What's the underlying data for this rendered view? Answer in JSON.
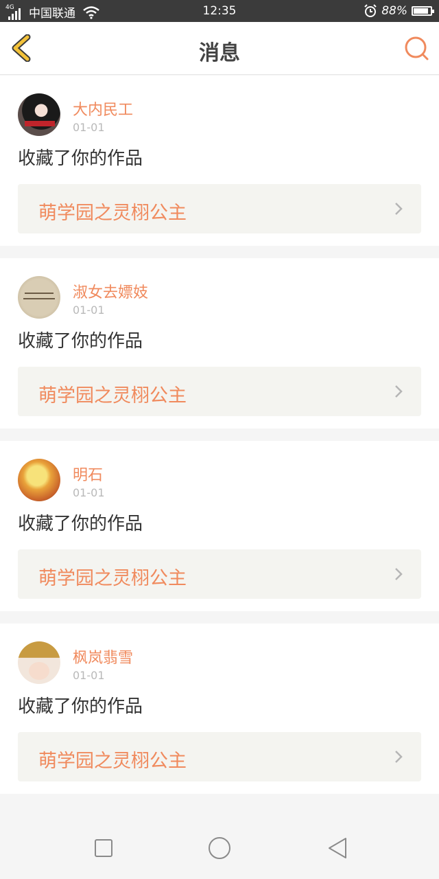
{
  "status_bar": {
    "network": "4G",
    "carrier": "中国联通",
    "time": "12:35",
    "battery": "88%",
    "battery_level": 0.88,
    "icons": [
      "signal-icon",
      "wifi-icon",
      "alarm-icon",
      "battery-icon"
    ]
  },
  "header": {
    "title": "消息",
    "back_icon": "chevron-left-icon",
    "search_icon": "search-icon"
  },
  "messages": [
    {
      "username": "大内民工",
      "date": "01-01",
      "action": "收藏了你的作品",
      "work_title": "萌学园之灵栩公主"
    },
    {
      "username": "淑女去嫖妓",
      "date": "01-01",
      "action": "收藏了你的作品",
      "work_title": "萌学园之灵栩公主"
    },
    {
      "username": "明石",
      "date": "01-01",
      "action": "收藏了你的作品",
      "work_title": "萌学园之灵栩公主"
    },
    {
      "username": "枫岚翡雪",
      "date": "01-01",
      "action": "收藏了你的作品",
      "work_title": "萌学园之灵栩公主"
    }
  ],
  "system_nav": {
    "icons": [
      "recent-apps-icon",
      "home-icon",
      "back-icon"
    ]
  },
  "colors": {
    "accent": "#f08a5d",
    "back_arrow": "#f3c23a",
    "status_bar": "#3b3b3b",
    "work_card_bg": "#f4f4f0"
  }
}
